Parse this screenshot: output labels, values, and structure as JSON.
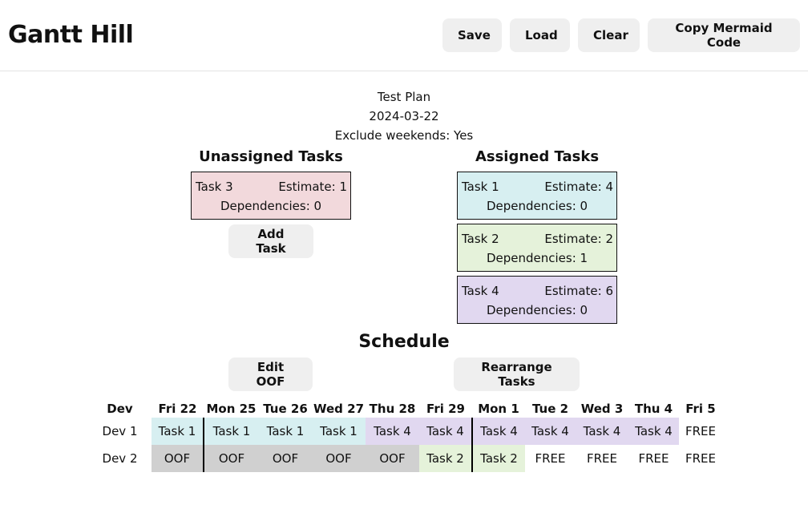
{
  "header": {
    "title": "Gantt Hill",
    "buttons": {
      "save": "Save",
      "load": "Load",
      "clear": "Clear",
      "copy_mermaid": "Copy Mermaid Code"
    }
  },
  "plan": {
    "name": "Test Plan",
    "date": "2024-03-22",
    "exclude_weekends": "Exclude weekends: Yes"
  },
  "unassigned": {
    "heading": "Unassigned Tasks",
    "tasks": [
      {
        "name": "Task 3",
        "estimate": "Estimate: 1",
        "dependencies": "Dependencies: 0",
        "color": "#f2d9dc"
      }
    ],
    "add_task_label": "Add Task"
  },
  "assigned": {
    "heading": "Assigned Tasks",
    "tasks": [
      {
        "name": "Task 1",
        "estimate": "Estimate: 4",
        "dependencies": "Dependencies: 0",
        "color": "#d7eff1"
      },
      {
        "name": "Task 2",
        "estimate": "Estimate: 2",
        "dependencies": "Dependencies: 1",
        "color": "#e5f2da"
      },
      {
        "name": "Task 4",
        "estimate": "Estimate: 6",
        "dependencies": "Dependencies: 0",
        "color": "#e1d8f0"
      }
    ]
  },
  "schedule": {
    "title": "Schedule",
    "edit_oof_label": "Edit OOF",
    "rearrange_label": "Rearrange Tasks",
    "dev_header": "Dev",
    "days": [
      "Fri 22",
      "Mon 25",
      "Tue 26",
      "Wed 27",
      "Thu 28",
      "Fri 29",
      "Mon 1",
      "Tue 2",
      "Wed 3",
      "Thu 4",
      "Fri 5"
    ],
    "rows": [
      {
        "dev": "Dev 1",
        "cells": [
          "Task 1",
          "Task 1",
          "Task 1",
          "Task 1",
          "Task 4",
          "Task 4",
          "Task 4",
          "Task 4",
          "Task 4",
          "Task 4",
          "FREE"
        ]
      },
      {
        "dev": "Dev 2",
        "cells": [
          "OOF",
          "OOF",
          "OOF",
          "OOF",
          "OOF",
          "Task 2",
          "Task 2",
          "FREE",
          "FREE",
          "FREE",
          "FREE"
        ]
      }
    ],
    "colors": {
      "Task 1": "#d7eff1",
      "Task 2": "#e5f2da",
      "Task 4": "#e1d8f0",
      "OOF": "#d0d0d0",
      "FREE": "#ffffff"
    }
  }
}
